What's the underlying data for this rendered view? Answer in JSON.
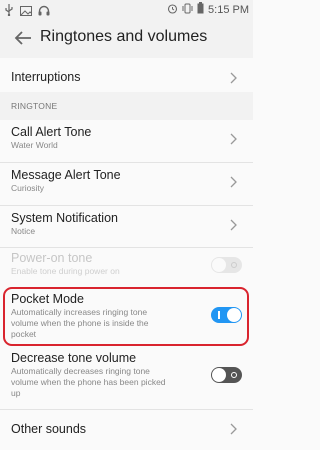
{
  "status_bar": {
    "time": "5:15 PM",
    "left_icons": [
      "usb-icon",
      "image-icon",
      "headset-icon"
    ],
    "right_icons": [
      "alarm-icon",
      "vibrate-icon",
      "battery-icon"
    ]
  },
  "header": {
    "title": "Ringtones and volumes"
  },
  "items": {
    "interruptions": {
      "label": "Interruptions"
    },
    "section_label": "RINGTONE",
    "call_alert": {
      "label": "Call Alert Tone",
      "value": "Water World"
    },
    "message_alert": {
      "label": "Message Alert Tone",
      "value": "Curiosity"
    },
    "system_notification": {
      "label": "System Notification",
      "value": "Notice"
    },
    "power_on_tone": {
      "label": "Power-on tone",
      "description": "Enable tone during power on",
      "enabled": false,
      "state": "off"
    },
    "pocket_mode": {
      "label": "Pocket Mode",
      "description_lines": [
        "Automatically increases ringing tone",
        "volume when the phone is inside the",
        "pocket"
      ],
      "state": "on"
    },
    "decrease_volume": {
      "label": "Decrease tone volume",
      "description_lines": [
        "Automatically decreases ringing tone",
        "volume when the phone has been picked",
        "up"
      ],
      "state": "off"
    },
    "other_sounds": {
      "label": "Other sounds"
    }
  },
  "colors": {
    "accent": "#2196f3",
    "highlight": "#d9242e"
  }
}
